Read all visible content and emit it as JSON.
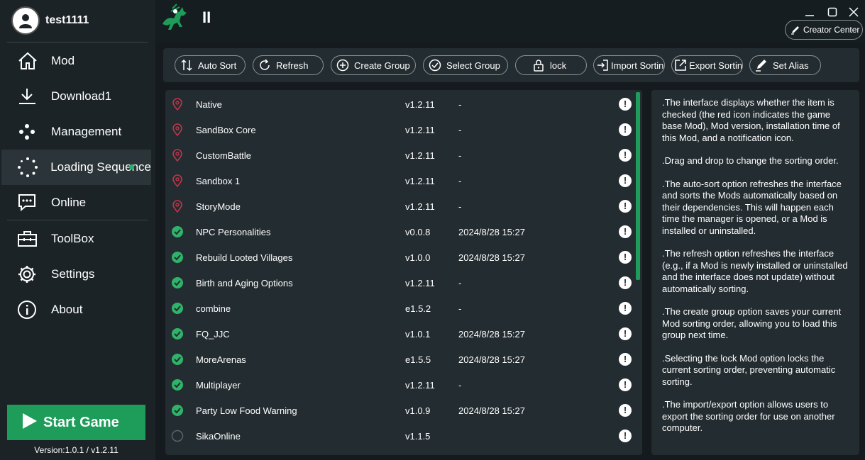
{
  "user": {
    "name": "test1111"
  },
  "sidebar": {
    "items": [
      {
        "label": "Mod",
        "icon": "home-icon"
      },
      {
        "label": "Download1",
        "icon": "download-icon"
      },
      {
        "label": "Management",
        "icon": "management-icon"
      },
      {
        "label": "Loading Sequence",
        "icon": "loading-icon",
        "active": true
      },
      {
        "label": "Online",
        "icon": "chat-icon"
      },
      {
        "label": "ToolBox",
        "icon": "toolbox-icon"
      },
      {
        "label": "Settings",
        "icon": "gear-icon"
      },
      {
        "label": "About",
        "icon": "info-icon"
      }
    ],
    "start_label": "Start Game",
    "version": "Version:1.0.1 / v1.2.11"
  },
  "header": {
    "pause_label": "II",
    "creator_label": "Creator Center"
  },
  "toolbar": {
    "buttons": [
      {
        "label": "Auto Sort",
        "icon": "sort-icon"
      },
      {
        "label": "Refresh",
        "icon": "refresh-icon"
      },
      {
        "label": "Create Group",
        "icon": "plus-circle-icon"
      },
      {
        "label": "Select Group",
        "icon": "check-circle-icon"
      },
      {
        "label": "lock",
        "icon": "lock-icon"
      },
      {
        "label": "Import Sorting",
        "icon": "import-icon"
      },
      {
        "label": "Export Sorting",
        "icon": "export-icon"
      },
      {
        "label": "Set Alias",
        "icon": "pen-icon"
      }
    ]
  },
  "mods": [
    {
      "name": "Native",
      "version": "v1.2.11",
      "date": "-",
      "status": "base"
    },
    {
      "name": "SandBox Core",
      "version": "v1.2.11",
      "date": "-",
      "status": "base"
    },
    {
      "name": "CustomBattle",
      "version": "v1.2.11",
      "date": "-",
      "status": "base"
    },
    {
      "name": "Sandbox    1",
      "version": "v1.2.11",
      "date": "-",
      "status": "base"
    },
    {
      "name": "StoryMode",
      "version": "v1.2.11",
      "date": "-",
      "status": "base"
    },
    {
      "name": "NPC Personalities",
      "version": "v0.0.8",
      "date": "2024/8/28 15:27",
      "status": "checked"
    },
    {
      "name": "Rebuild Looted Villages",
      "version": "v1.0.0",
      "date": "2024/8/28 15:27",
      "status": "checked"
    },
    {
      "name": "Birth and Aging Options",
      "version": "v1.2.11",
      "date": "-",
      "status": "checked"
    },
    {
      "name": "combine",
      "version": "e1.5.2",
      "date": "-",
      "status": "checked"
    },
    {
      "name": "FQ_JJC",
      "version": "v1.0.1",
      "date": "2024/8/28 15:27",
      "status": "checked"
    },
    {
      "name": "MoreArenas",
      "version": "e1.5.5",
      "date": "2024/8/28 15:27",
      "status": "checked"
    },
    {
      "name": "Multiplayer",
      "version": "v1.2.11",
      "date": "-",
      "status": "checked"
    },
    {
      "name": "Party Low Food Warning",
      "version": "v1.0.9",
      "date": "2024/8/28 15:27",
      "status": "checked"
    },
    {
      "name": "SikaOnline",
      "version": "v1.1.5",
      "date": "",
      "status": "unchecked"
    }
  ],
  "note_glyph": "!",
  "help": [
    ".The interface displays whether the item is checked (the red icon indicates the game base Mod), Mod version, installation time of this Mod, and a notification icon.",
    ".Drag and drop to change the sorting order.",
    ".The auto-sort option refreshes the interface and sorts the Mods automatically based on their dependencies. This will happen each time the manager is opened, or a Mod is installed or uninstalled.",
    ".The refresh option refreshes the interface (e.g., if a Mod is newly installed or uninstalled and the interface does not update) without automatically sorting.",
    ".The create group option saves your current Mod sorting order, allowing you to load this group next time.",
    ".Selecting the lock Mod option locks the current sorting order, preventing automatic sorting.",
    ".The import/export option allows users to export the sorting order for use on another computer."
  ],
  "colors": {
    "accent": "#1e9c5a",
    "base_mod": "#c0354a",
    "checked": "#2fb36a",
    "panel": "#232c30"
  }
}
